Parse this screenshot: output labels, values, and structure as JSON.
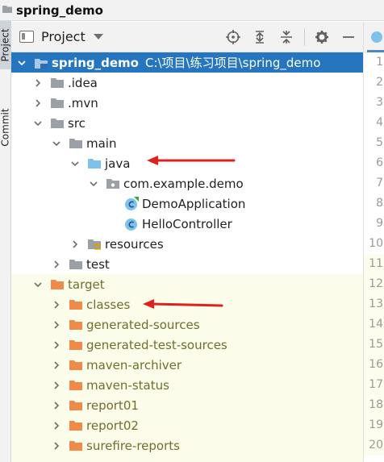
{
  "window": {
    "title": "spring_demo"
  },
  "left_strip": {
    "project_tab": "Project",
    "commit_tab": "Commit"
  },
  "panel": {
    "selector_label": "Project",
    "icons": [
      "crosshair-icon",
      "expand-all-icon",
      "collapse-all-icon",
      "gear-icon",
      "minimize-icon"
    ]
  },
  "editor": {
    "line_numbers": [
      "1",
      "2",
      "3",
      "4",
      "5",
      "6",
      "7",
      "8",
      "9",
      "10",
      "11",
      "12",
      "13",
      "14",
      "15",
      "16",
      "17",
      "18",
      "19",
      "20"
    ]
  },
  "tree": {
    "root": {
      "name": "spring_demo",
      "path": "C:\\项目\\练习项目\\spring_demo"
    },
    "idea": ".idea",
    "mvn": ".mvn",
    "src": "src",
    "main": "main",
    "java": "java",
    "package": "com.example.demo",
    "demo_app": "DemoApplication",
    "hello_ctrl": "HelloController",
    "resources": "resources",
    "test": "test",
    "target": "target",
    "classes": "classes",
    "generated_sources": "generated-sources",
    "generated_test_sources": "generated-test-sources",
    "maven_archiver": "maven-archiver",
    "maven_status": "maven-status",
    "report01": "report01",
    "report02": "report02",
    "surefire_reports": "surefire-reports"
  },
  "colors": {
    "selection": "#2675bf",
    "excluded_bg": "#fcfcea",
    "arrow": "#e0201c",
    "folder_orange": "#f08a4b",
    "folder_blue": "#7cc2ea",
    "folder_gray": "#9aa0a6"
  }
}
